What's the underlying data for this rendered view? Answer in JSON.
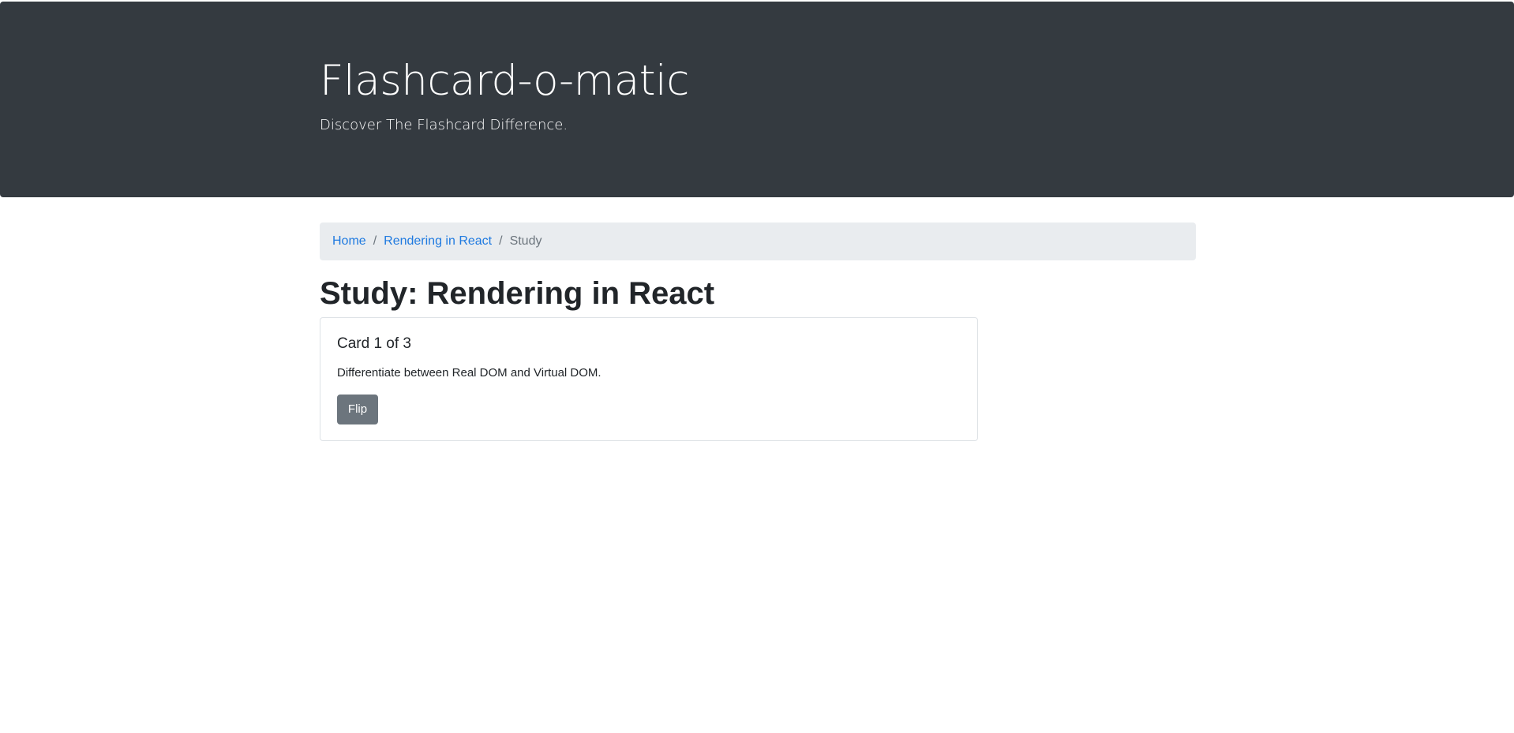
{
  "header": {
    "title": "Flashcard-o-matic",
    "lead": "Discover The Flashcard Difference."
  },
  "breadcrumb": {
    "home": "Home",
    "deck": "Rendering in React",
    "separator": "/",
    "current": "Study"
  },
  "page": {
    "title": "Study: Rendering in React"
  },
  "card": {
    "counter": "Card 1 of 3",
    "text": "Differentiate between Real DOM and Virtual DOM.",
    "flip_label": "Flip"
  },
  "colors": {
    "header_bg": "#343a40",
    "breadcrumb_bg": "#e9ecef",
    "link": "#1f7ae0",
    "button_secondary": "#6c757d"
  }
}
